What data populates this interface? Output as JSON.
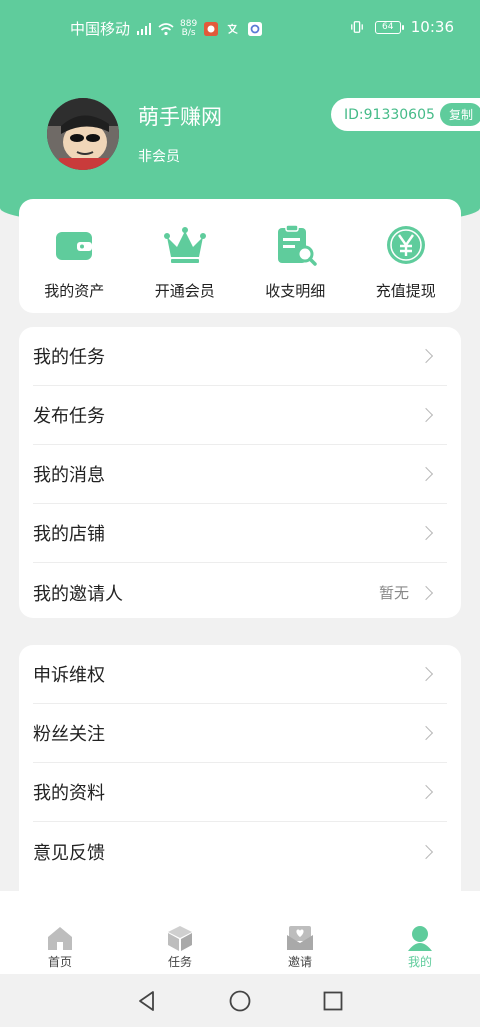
{
  "status_bar": {
    "carrier": "中国移动",
    "net_speed_value": "889",
    "net_speed_unit": "B/s",
    "battery": "64",
    "time": "10:36"
  },
  "profile": {
    "username": "萌手赚网",
    "member_status": "非会员",
    "id_text": "ID:91330605",
    "copy_label": "复制"
  },
  "quick_actions": [
    {
      "label": "我的资产",
      "icon": "wallet-icon"
    },
    {
      "label": "开通会员",
      "icon": "crown-icon"
    },
    {
      "label": "收支明细",
      "icon": "clipboard-search-icon"
    },
    {
      "label": "充值提现",
      "icon": "yen-coin-icon"
    }
  ],
  "menu_group_1": [
    {
      "label": "我的任务"
    },
    {
      "label": "发布任务"
    },
    {
      "label": "我的消息"
    },
    {
      "label": "我的店铺"
    },
    {
      "label": "我的邀请人",
      "value": "暂无"
    }
  ],
  "menu_group_2": [
    {
      "label": "申诉维权"
    },
    {
      "label": "粉丝关注"
    },
    {
      "label": "我的资料"
    },
    {
      "label": "意见反馈"
    }
  ],
  "tabs": [
    {
      "label": "首页",
      "icon": "home-icon"
    },
    {
      "label": "任务",
      "icon": "cube-icon"
    },
    {
      "label": "邀请",
      "icon": "invite-envelope-icon"
    },
    {
      "label": "我的",
      "icon": "person-icon",
      "active": true
    }
  ],
  "colors": {
    "accent": "#5fcc9c",
    "background": "#f1f1f1",
    "tab_inactive": "#bdbdbd"
  }
}
